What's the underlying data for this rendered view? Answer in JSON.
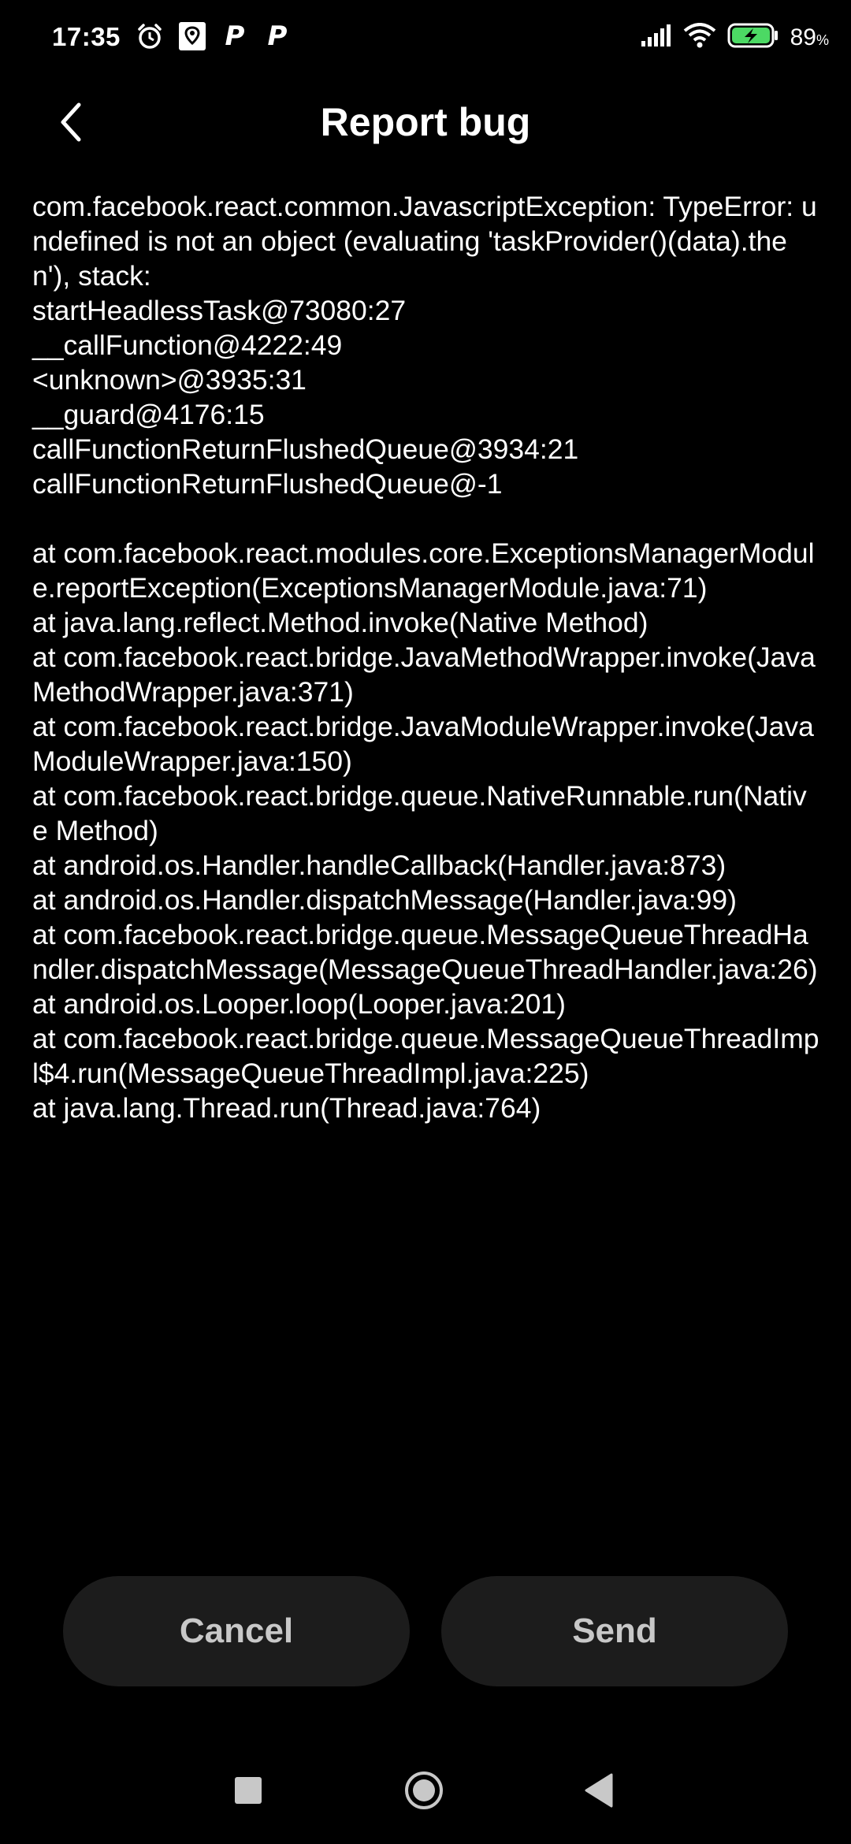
{
  "status_bar": {
    "time": "17:35",
    "battery_percent": "89",
    "battery_unit": "%",
    "icons_left": [
      "alarm-icon",
      "maps-icon",
      "p-icon",
      "p-icon"
    ],
    "icons_right": [
      "signal-icon",
      "wifi-icon",
      "battery-charging-icon"
    ],
    "p_label": "P"
  },
  "header": {
    "title": "Report bug",
    "back_icon": "chevron-left-icon"
  },
  "report": {
    "text": "com.facebook.react.common.JavascriptException: TypeError: undefined is not an object (evaluating 'taskProvider()(data).then'), stack:\nstartHeadlessTask@73080:27\n__callFunction@4222:49\n<unknown>@3935:31\n__guard@4176:15\ncallFunctionReturnFlushedQueue@3934:21\ncallFunctionReturnFlushedQueue@-1\n\n  at com.facebook.react.modules.core.ExceptionsManagerModule.reportException(ExceptionsManagerModule.java:71)\n  at java.lang.reflect.Method.invoke(Native Method)\n  at com.facebook.react.bridge.JavaMethodWrapper.invoke(JavaMethodWrapper.java:371)\n  at com.facebook.react.bridge.JavaModuleWrapper.invoke(JavaModuleWrapper.java:150)\n  at com.facebook.react.bridge.queue.NativeRunnable.run(Native Method)\n  at android.os.Handler.handleCallback(Handler.java:873)\n  at android.os.Handler.dispatchMessage(Handler.java:99)\n  at com.facebook.react.bridge.queue.MessageQueueThreadHandler.dispatchMessage(MessageQueueThreadHandler.java:26)\n  at android.os.Looper.loop(Looper.java:201)\n  at com.facebook.react.bridge.queue.MessageQueueThreadImpl$4.run(MessageQueueThreadImpl.java:225)\n  at java.lang.Thread.run(Thread.java:764)"
  },
  "actions": {
    "cancel_label": "Cancel",
    "send_label": "Send"
  },
  "nav_bar": {
    "icons": [
      "recents-square-icon",
      "home-circle-icon",
      "back-triangle-icon"
    ]
  },
  "colors": {
    "background": "#000000",
    "text": "#ffffff",
    "button_bg": "#1c1c1c",
    "button_text": "#c8c8c8",
    "battery_green": "#4cd964"
  }
}
